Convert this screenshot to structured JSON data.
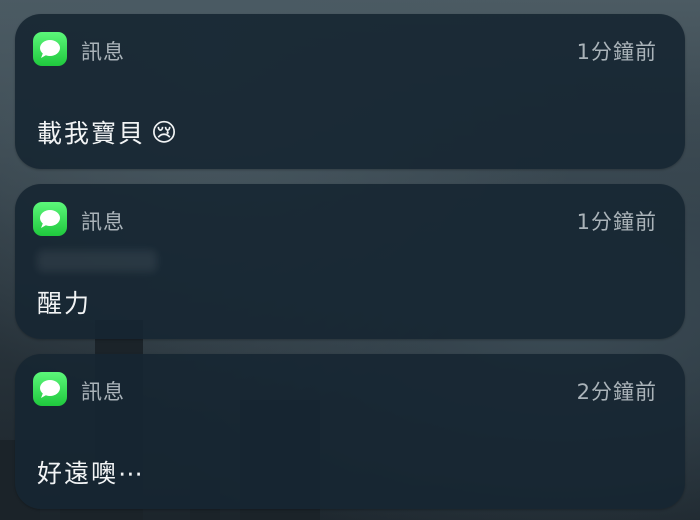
{
  "notifications": [
    {
      "app": "訊息",
      "time": "1分鐘前",
      "message": "載我寶貝",
      "emoji": "😢"
    },
    {
      "app": "訊息",
      "time": "1分鐘前",
      "message": "醒力",
      "emoji": ""
    },
    {
      "app": "訊息",
      "time": "2分鐘前",
      "message": "好遠噢⋯",
      "emoji": ""
    }
  ],
  "colors": {
    "card": "#162632",
    "accent": "#2fd84f",
    "text": "#f2f4f5",
    "secondary": "#aab3b9"
  }
}
